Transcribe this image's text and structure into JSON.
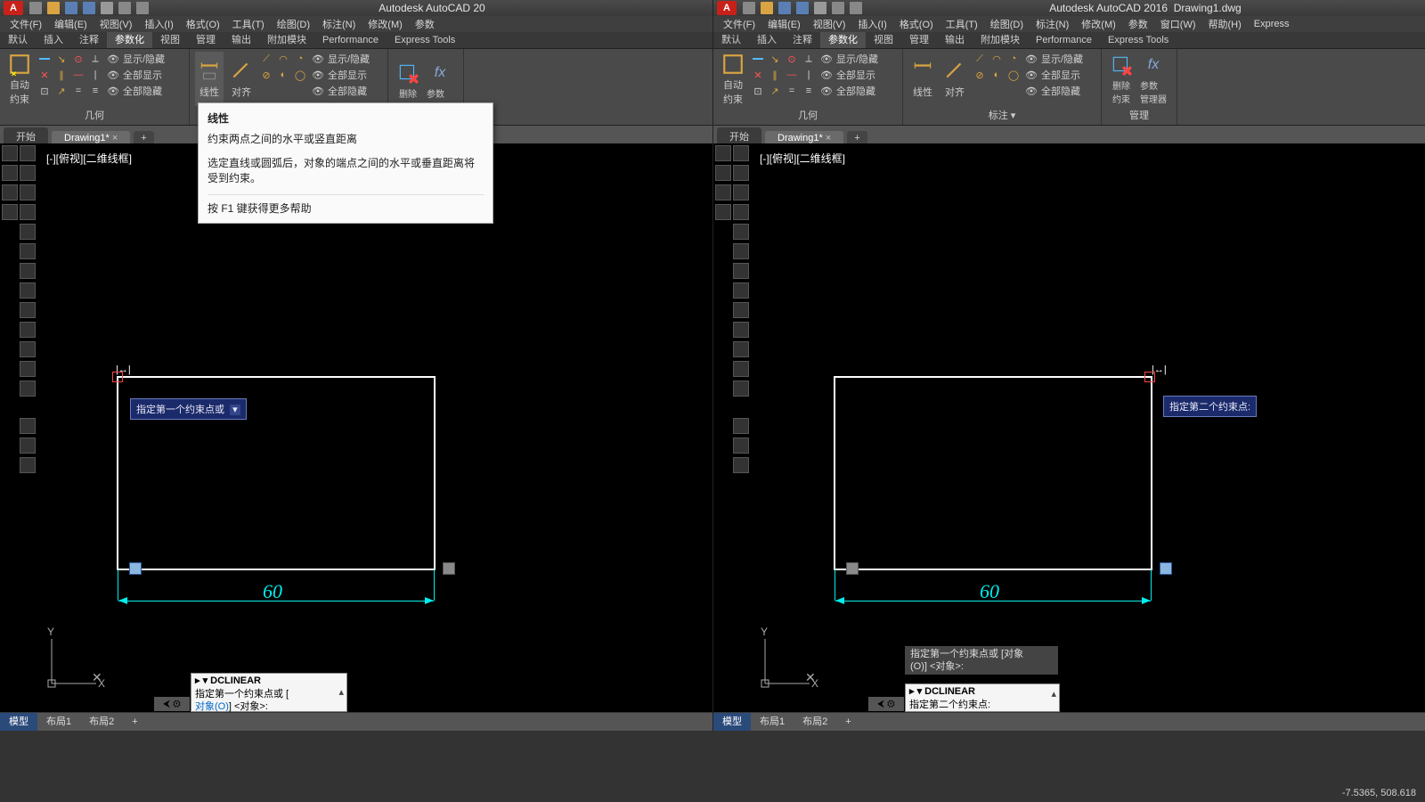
{
  "app": {
    "logo": "A",
    "title_left": "Autodesk AutoCAD 20",
    "title_right": "Autodesk AutoCAD 2016",
    "doc": "Drawing1.dwg"
  },
  "menu": [
    "文件(F)",
    "编辑(E)",
    "视图(V)",
    "插入(I)",
    "格式(O)",
    "工具(T)",
    "绘图(D)",
    "标注(N)",
    "修改(M)",
    "参数",
    "窗口(W)",
    "帮助(H)",
    "Express"
  ],
  "menu_left": [
    "文件(F)",
    "编辑(E)",
    "视图(V)",
    "插入(I)",
    "格式(O)",
    "工具(T)",
    "绘图(D)",
    "标注(N)",
    "修改(M)",
    "参数"
  ],
  "ribbontabs": [
    "默认",
    "插入",
    "注释",
    "参数化",
    "视图",
    "管理",
    "输出",
    "附加模块",
    "Performance",
    "Express Tools"
  ],
  "ribbontab_active": "参数化",
  "panels": {
    "auto": {
      "btn": "自动\n约束",
      "lbl": "几何",
      "show": "显示/隐藏",
      "all": "全部显示",
      "hide": "全部隐藏"
    },
    "dim": {
      "linear": "线性",
      "align": "对齐",
      "lbl": "标注 ▾",
      "show": "显示/隐藏",
      "all": "全部显示",
      "hide": "全部隐藏"
    },
    "manage": {
      "del": "删除\n约束",
      "param": "参数\n管理器",
      "lbl": "管理",
      "fx": "fx"
    }
  },
  "tabs": {
    "start": "开始",
    "file": "Drawing1*",
    "plus": "+",
    "close": "×"
  },
  "viewport": "[-][俯视][二维线框]",
  "tooltip": {
    "title": "线性",
    "body1": "约束两点之间的水平或竖直距离",
    "body2": "选定直线或圆弧后，对象的端点之间的水平或垂直距离将受到约束。",
    "f1": "按 F1 键获得更多帮助"
  },
  "prompt_left": "指定第一个约束点或",
  "prompt_left_opt": "▾",
  "prompt_right": "指定第二个约束点:",
  "dim_value": "60",
  "cmd_left": {
    "cmd": "DCLINEAR",
    "line1": "指定第一个约束点或 [",
    "line2": "对象(O)] <对象>:"
  },
  "cmd_right": {
    "cmd": "DCLINEAR",
    "line": "指定第二个约束点:"
  },
  "hist_right": {
    "l1": "指定第一个约束点或 [对象",
    "l2": "(O)] <对象>:"
  },
  "layouts": {
    "model": "模型",
    "l1": "布局1",
    "l2": "布局2",
    "plus": "+"
  },
  "coords": "-7.5365, 508.618",
  "ucs": {
    "x": "X",
    "y": "Y"
  },
  "cursor_sym": "|↔|"
}
